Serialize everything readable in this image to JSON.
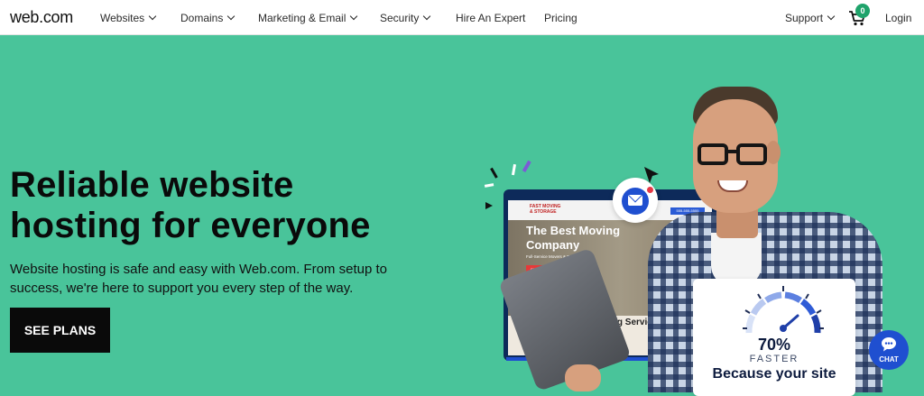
{
  "nav": {
    "logo": "web.com",
    "items": [
      {
        "label": "Websites",
        "dropdown": true
      },
      {
        "label": "Domains",
        "dropdown": true
      },
      {
        "label": "Marketing & Email",
        "dropdown": true
      },
      {
        "label": "Security",
        "dropdown": true
      },
      {
        "label": "Hire An Expert",
        "dropdown": false
      },
      {
        "label": "Pricing",
        "dropdown": false
      }
    ],
    "support": "Support",
    "cart_count": "0",
    "login": "Login"
  },
  "hero": {
    "headline_line1": "Reliable website",
    "headline_line2": "hosting for everyone",
    "sub_line1": "Website hosting is safe and easy with Web.com. From setup to",
    "sub_line2": "success, we're here to support you every step of the way.",
    "cta": "SEE PLANS"
  },
  "illustration": {
    "screen_logo_line1": "FAST MOVING",
    "screen_logo_line2": "& STORAGE",
    "screen_title_line1": "The Best Moving",
    "screen_title_line2": "Company",
    "screen_sub": "Full-Service Movers & Packers",
    "screen_btn": "GET A FREE QUOTE",
    "screen_phone": "555-555-5555",
    "screen_lower": "Moving Service",
    "gauge_value": "70%",
    "gauge_faster": "FASTER",
    "gauge_because": "Because your site"
  },
  "chat": {
    "label": "CHAT"
  },
  "colors": {
    "hero_bg": "#49c49a",
    "accent_blue": "#1f4fd0",
    "badge_green": "#1fa36b"
  }
}
